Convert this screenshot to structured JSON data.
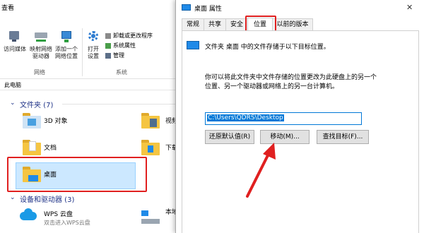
{
  "explorer": {
    "tab_label": "查看",
    "ribbon": {
      "network_group": {
        "items": [
          {
            "label_line1": "访问媒体",
            "label_line2": ""
          },
          {
            "label_line1": "映射网络",
            "label_line2": "驱动器"
          },
          {
            "label_line1": "添加一个",
            "label_line2": "网络位置"
          }
        ],
        "group_label": "网络"
      },
      "system_group": {
        "open_settings": {
          "label_line1": "打开",
          "label_line2": "设置"
        },
        "items": [
          "卸载或更改程序",
          "系统属性",
          "管理"
        ],
        "group_label": "系统"
      }
    },
    "address": "此电脑",
    "folders_section": {
      "title": "文件夹 (7)"
    },
    "folders": [
      "3D 对象",
      "文档",
      "桌面",
      "视频",
      "下载"
    ],
    "devices_section": {
      "title": "设备和驱动器 (3)"
    },
    "devices": [
      {
        "name": "WPS 云盘",
        "sub": "双击进入WPS云盘"
      },
      {
        "name": "本地"
      }
    ]
  },
  "dialog": {
    "title": "桌面 属性",
    "close_glyph": "✕",
    "tabs": [
      "常规",
      "共享",
      "安全",
      "位置",
      "以前的版本"
    ],
    "active_tab": "位置",
    "header_text": "文件夹 桌面 中的文件存储于以下目标位置。",
    "description_line1": "你可以将此文件夹中文件存储的位置更改为此硬盘上的另一个",
    "description_line2": "位置、另一个驱动器或网络上的另一台计算机。",
    "path_value": "C:\\Users\\QDRS\\Desktop",
    "buttons": {
      "restore": "还原默认值(R)",
      "move": "移动(M)...",
      "find_target": "查找目标(F)..."
    }
  },
  "colors": {
    "highlight_red": "#e02020",
    "accent_blue": "#0078d7",
    "folder_yellow": "#f5c542"
  }
}
